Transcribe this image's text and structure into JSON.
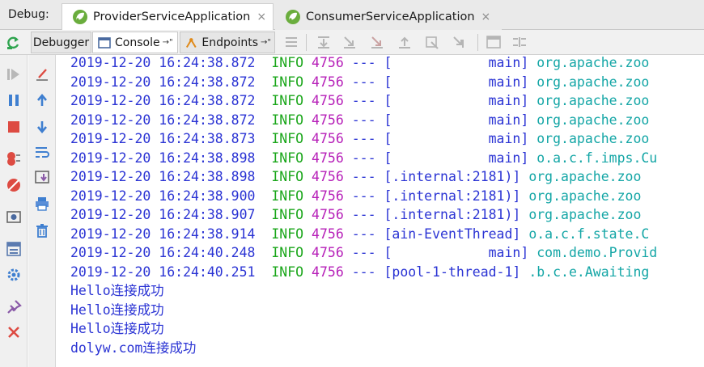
{
  "colors": {
    "timestamp": "#2b34d4",
    "level": "#1aa61a",
    "pid": "#b61fb8",
    "logger": "#14a6a6",
    "output": "#2b34d4"
  },
  "header": {
    "debug_label": "Debug:",
    "tabs": [
      {
        "label": "ProviderServiceApplication",
        "icon": "spring-boot-icon",
        "active": true
      },
      {
        "label": "ConsumerServiceApplication",
        "icon": "spring-boot-icon",
        "active": false
      }
    ],
    "close_glyph": "×"
  },
  "toolbar": {
    "debugger_label": "Debugger",
    "console_label": "Console",
    "endpoints_label": "Endpoints",
    "pin_glyph": "→\""
  },
  "log": [
    {
      "ts": "2019-12-20 16:24:38.872",
      "level": "INFO",
      "pid": "4756",
      "sep": "---",
      "thread": "[            main]",
      "logger": "org.apache.zoo"
    },
    {
      "ts": "2019-12-20 16:24:38.872",
      "level": "INFO",
      "pid": "4756",
      "sep": "---",
      "thread": "[            main]",
      "logger": "org.apache.zoo"
    },
    {
      "ts": "2019-12-20 16:24:38.872",
      "level": "INFO",
      "pid": "4756",
      "sep": "---",
      "thread": "[            main]",
      "logger": "org.apache.zoo"
    },
    {
      "ts": "2019-12-20 16:24:38.872",
      "level": "INFO",
      "pid": "4756",
      "sep": "---",
      "thread": "[            main]",
      "logger": "org.apache.zoo"
    },
    {
      "ts": "2019-12-20 16:24:38.873",
      "level": "INFO",
      "pid": "4756",
      "sep": "---",
      "thread": "[            main]",
      "logger": "org.apache.zoo"
    },
    {
      "ts": "2019-12-20 16:24:38.898",
      "level": "INFO",
      "pid": "4756",
      "sep": "---",
      "thread": "[            main]",
      "logger": "o.a.c.f.imps.Cu"
    },
    {
      "ts": "2019-12-20 16:24:38.898",
      "level": "INFO",
      "pid": "4756",
      "sep": "---",
      "thread": "[.internal:2181)]",
      "logger": "org.apache.zoo"
    },
    {
      "ts": "2019-12-20 16:24:38.900",
      "level": "INFO",
      "pid": "4756",
      "sep": "---",
      "thread": "[.internal:2181)]",
      "logger": "org.apache.zoo"
    },
    {
      "ts": "2019-12-20 16:24:38.907",
      "level": "INFO",
      "pid": "4756",
      "sep": "---",
      "thread": "[.internal:2181)]",
      "logger": "org.apache.zoo"
    },
    {
      "ts": "2019-12-20 16:24:38.914",
      "level": "INFO",
      "pid": "4756",
      "sep": "---",
      "thread": "[ain-EventThread]",
      "logger": "o.a.c.f.state.C"
    },
    {
      "ts": "2019-12-20 16:24:40.248",
      "level": "INFO",
      "pid": "4756",
      "sep": "---",
      "thread": "[            main]",
      "logger": "com.demo.Provid"
    },
    {
      "ts": "2019-12-20 16:24:40.251",
      "level": "INFO",
      "pid": "4756",
      "sep": "---",
      "thread": "[pool-1-thread-1]",
      "logger": ".b.c.e.Awaiting"
    }
  ],
  "output": [
    "Hello连接成功",
    "Hello连接成功",
    "Hello连接成功",
    "dolyw.com连接成功"
  ]
}
